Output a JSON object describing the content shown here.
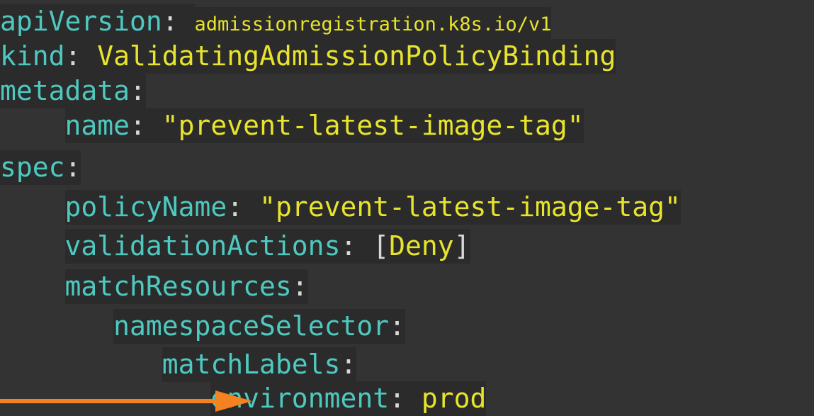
{
  "colors": {
    "background": "#333333",
    "key": "#4ec9c0",
    "value": "#e8e42c",
    "punctuation": "#d8d8d8",
    "arrow": "#f58220"
  },
  "arrow_icon": "arrow-right-icon",
  "lines": {
    "api_version": {
      "key": "apiVersion",
      "colon": ": ",
      "value": "admissionregistration.k8s.io/v1"
    },
    "kind": {
      "key": "kind",
      "colon": ": ",
      "value": "ValidatingAdmissionPolicyBinding"
    },
    "metadata": {
      "key": "metadata",
      "colon": ":"
    },
    "name": {
      "indent": "    ",
      "key": "name",
      "colon": ": ",
      "value": "\"prevent-latest-image-tag\""
    },
    "spec": {
      "key": "spec",
      "colon": ":"
    },
    "policy_name": {
      "indent": "    ",
      "key": "policyName",
      "colon": ": ",
      "value": "\"prevent-latest-image-tag\""
    },
    "validation_actions": {
      "indent": "    ",
      "key": "validationActions",
      "colon": ": ",
      "bracket_open": "[",
      "value": "Deny",
      "bracket_close": "]"
    },
    "match_resources": {
      "indent": "    ",
      "key": "matchResources",
      "colon": ":"
    },
    "namespace_selector": {
      "indent": "       ",
      "key": "namespaceSelector",
      "colon": ":"
    },
    "match_labels": {
      "indent": "          ",
      "key": "matchLabels",
      "colon": ":"
    },
    "environment": {
      "indent": "             ",
      "key": "environment",
      "colon": ": ",
      "value": "prod"
    }
  }
}
